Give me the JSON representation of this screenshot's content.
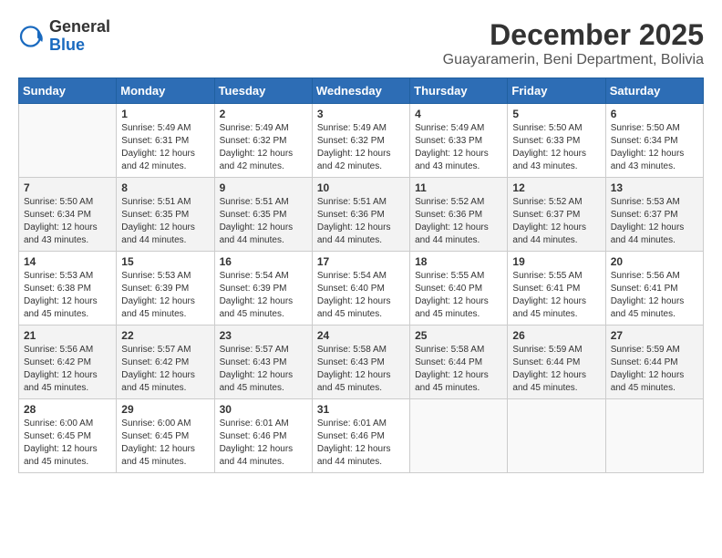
{
  "header": {
    "logo_general": "General",
    "logo_blue": "Blue",
    "month_title": "December 2025",
    "location": "Guayaramerin, Beni Department, Bolivia"
  },
  "days_of_week": [
    "Sunday",
    "Monday",
    "Tuesday",
    "Wednesday",
    "Thursday",
    "Friday",
    "Saturday"
  ],
  "weeks": [
    [
      {
        "day": "",
        "empty": true
      },
      {
        "day": "1",
        "sunrise": "Sunrise: 5:49 AM",
        "sunset": "Sunset: 6:31 PM",
        "daylight": "Daylight: 12 hours and 42 minutes."
      },
      {
        "day": "2",
        "sunrise": "Sunrise: 5:49 AM",
        "sunset": "Sunset: 6:32 PM",
        "daylight": "Daylight: 12 hours and 42 minutes."
      },
      {
        "day": "3",
        "sunrise": "Sunrise: 5:49 AM",
        "sunset": "Sunset: 6:32 PM",
        "daylight": "Daylight: 12 hours and 42 minutes."
      },
      {
        "day": "4",
        "sunrise": "Sunrise: 5:49 AM",
        "sunset": "Sunset: 6:33 PM",
        "daylight": "Daylight: 12 hours and 43 minutes."
      },
      {
        "day": "5",
        "sunrise": "Sunrise: 5:50 AM",
        "sunset": "Sunset: 6:33 PM",
        "daylight": "Daylight: 12 hours and 43 minutes."
      },
      {
        "day": "6",
        "sunrise": "Sunrise: 5:50 AM",
        "sunset": "Sunset: 6:34 PM",
        "daylight": "Daylight: 12 hours and 43 minutes."
      }
    ],
    [
      {
        "day": "7",
        "sunrise": "Sunrise: 5:50 AM",
        "sunset": "Sunset: 6:34 PM",
        "daylight": "Daylight: 12 hours and 43 minutes."
      },
      {
        "day": "8",
        "sunrise": "Sunrise: 5:51 AM",
        "sunset": "Sunset: 6:35 PM",
        "daylight": "Daylight: 12 hours and 44 minutes."
      },
      {
        "day": "9",
        "sunrise": "Sunrise: 5:51 AM",
        "sunset": "Sunset: 6:35 PM",
        "daylight": "Daylight: 12 hours and 44 minutes."
      },
      {
        "day": "10",
        "sunrise": "Sunrise: 5:51 AM",
        "sunset": "Sunset: 6:36 PM",
        "daylight": "Daylight: 12 hours and 44 minutes."
      },
      {
        "day": "11",
        "sunrise": "Sunrise: 5:52 AM",
        "sunset": "Sunset: 6:36 PM",
        "daylight": "Daylight: 12 hours and 44 minutes."
      },
      {
        "day": "12",
        "sunrise": "Sunrise: 5:52 AM",
        "sunset": "Sunset: 6:37 PM",
        "daylight": "Daylight: 12 hours and 44 minutes."
      },
      {
        "day": "13",
        "sunrise": "Sunrise: 5:53 AM",
        "sunset": "Sunset: 6:37 PM",
        "daylight": "Daylight: 12 hours and 44 minutes."
      }
    ],
    [
      {
        "day": "14",
        "sunrise": "Sunrise: 5:53 AM",
        "sunset": "Sunset: 6:38 PM",
        "daylight": "Daylight: 12 hours and 45 minutes."
      },
      {
        "day": "15",
        "sunrise": "Sunrise: 5:53 AM",
        "sunset": "Sunset: 6:39 PM",
        "daylight": "Daylight: 12 hours and 45 minutes."
      },
      {
        "day": "16",
        "sunrise": "Sunrise: 5:54 AM",
        "sunset": "Sunset: 6:39 PM",
        "daylight": "Daylight: 12 hours and 45 minutes."
      },
      {
        "day": "17",
        "sunrise": "Sunrise: 5:54 AM",
        "sunset": "Sunset: 6:40 PM",
        "daylight": "Daylight: 12 hours and 45 minutes."
      },
      {
        "day": "18",
        "sunrise": "Sunrise: 5:55 AM",
        "sunset": "Sunset: 6:40 PM",
        "daylight": "Daylight: 12 hours and 45 minutes."
      },
      {
        "day": "19",
        "sunrise": "Sunrise: 5:55 AM",
        "sunset": "Sunset: 6:41 PM",
        "daylight": "Daylight: 12 hours and 45 minutes."
      },
      {
        "day": "20",
        "sunrise": "Sunrise: 5:56 AM",
        "sunset": "Sunset: 6:41 PM",
        "daylight": "Daylight: 12 hours and 45 minutes."
      }
    ],
    [
      {
        "day": "21",
        "sunrise": "Sunrise: 5:56 AM",
        "sunset": "Sunset: 6:42 PM",
        "daylight": "Daylight: 12 hours and 45 minutes."
      },
      {
        "day": "22",
        "sunrise": "Sunrise: 5:57 AM",
        "sunset": "Sunset: 6:42 PM",
        "daylight": "Daylight: 12 hours and 45 minutes."
      },
      {
        "day": "23",
        "sunrise": "Sunrise: 5:57 AM",
        "sunset": "Sunset: 6:43 PM",
        "daylight": "Daylight: 12 hours and 45 minutes."
      },
      {
        "day": "24",
        "sunrise": "Sunrise: 5:58 AM",
        "sunset": "Sunset: 6:43 PM",
        "daylight": "Daylight: 12 hours and 45 minutes."
      },
      {
        "day": "25",
        "sunrise": "Sunrise: 5:58 AM",
        "sunset": "Sunset: 6:44 PM",
        "daylight": "Daylight: 12 hours and 45 minutes."
      },
      {
        "day": "26",
        "sunrise": "Sunrise: 5:59 AM",
        "sunset": "Sunset: 6:44 PM",
        "daylight": "Daylight: 12 hours and 45 minutes."
      },
      {
        "day": "27",
        "sunrise": "Sunrise: 5:59 AM",
        "sunset": "Sunset: 6:44 PM",
        "daylight": "Daylight: 12 hours and 45 minutes."
      }
    ],
    [
      {
        "day": "28",
        "sunrise": "Sunrise: 6:00 AM",
        "sunset": "Sunset: 6:45 PM",
        "daylight": "Daylight: 12 hours and 45 minutes."
      },
      {
        "day": "29",
        "sunrise": "Sunrise: 6:00 AM",
        "sunset": "Sunset: 6:45 PM",
        "daylight": "Daylight: 12 hours and 45 minutes."
      },
      {
        "day": "30",
        "sunrise": "Sunrise: 6:01 AM",
        "sunset": "Sunset: 6:46 PM",
        "daylight": "Daylight: 12 hours and 44 minutes."
      },
      {
        "day": "31",
        "sunrise": "Sunrise: 6:01 AM",
        "sunset": "Sunset: 6:46 PM",
        "daylight": "Daylight: 12 hours and 44 minutes."
      },
      {
        "day": "",
        "empty": true
      },
      {
        "day": "",
        "empty": true
      },
      {
        "day": "",
        "empty": true
      }
    ]
  ]
}
